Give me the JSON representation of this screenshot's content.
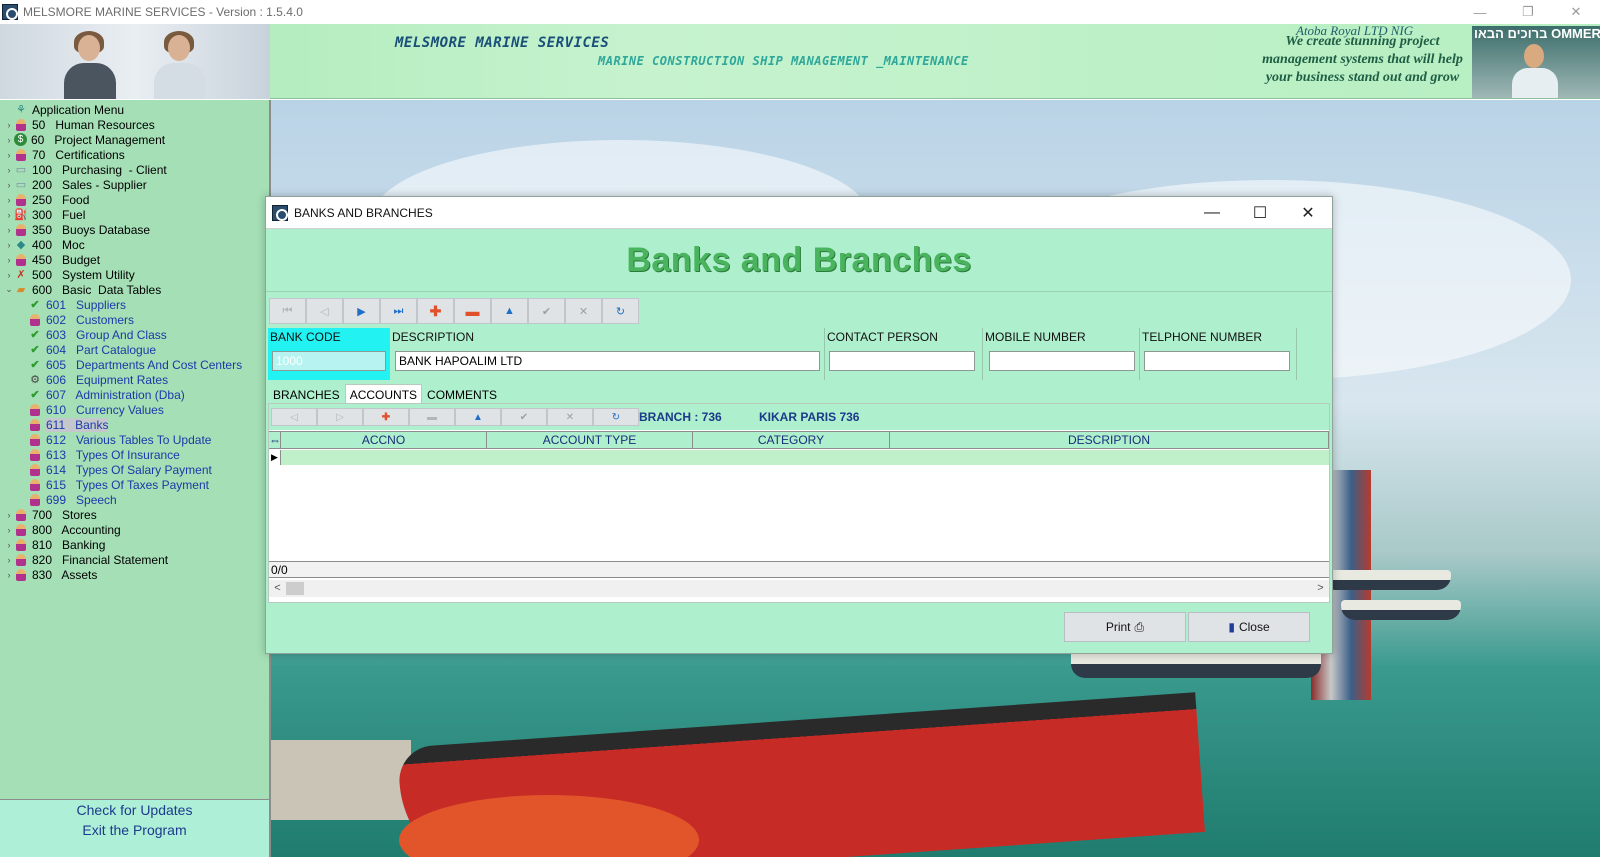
{
  "app": {
    "window_title": "MELSMORE MARINE SERVICES - Version : 1.5.4.0",
    "window_controls": [
      "—",
      "❐",
      "✕"
    ]
  },
  "banner": {
    "company": "MELSMORE MARINE SERVICES",
    "subtitle": "MARINE CONSTRUCTION SHIP MANAGEMENT _MAINTENANCE",
    "tag_title": "Atoba Royal LTD NIG",
    "slogan": "We create stunning project management systems that will help your business stand out and grow",
    "right_photo_text": "ברוכים הבאו OMMERCE"
  },
  "menu": {
    "items": [
      {
        "label": "Application Menu",
        "icon": "tree-icon",
        "expander": "",
        "level": "root"
      },
      {
        "label": "50   Human Resources",
        "icon": "person-icon",
        "expander": "›",
        "level": "top"
      },
      {
        "label": "60   Project Management",
        "icon": "dollar-icon",
        "expander": "›",
        "level": "top"
      },
      {
        "label": "70   Certifications",
        "icon": "person-icon",
        "expander": "›",
        "level": "top"
      },
      {
        "label": "100   Purchasing  - Client",
        "icon": "box-icon",
        "expander": "›",
        "level": "top"
      },
      {
        "label": "200   Sales - Supplier",
        "icon": "box-icon",
        "expander": "›",
        "level": "top"
      },
      {
        "label": "250   Food",
        "icon": "person-icon",
        "expander": "›",
        "level": "top"
      },
      {
        "label": "300   Fuel",
        "icon": "fuel-icon",
        "expander": "›",
        "level": "top"
      },
      {
        "label": "350   Buoys Database",
        "icon": "person-icon",
        "expander": "›",
        "level": "top"
      },
      {
        "label": "400   Moc",
        "icon": "diamond-icon",
        "expander": "›",
        "level": "top"
      },
      {
        "label": "450   Budget",
        "icon": "person-icon",
        "expander": "›",
        "level": "top"
      },
      {
        "label": "500   System Utility",
        "icon": "tools-icon",
        "expander": "›",
        "level": "top"
      },
      {
        "label": "600   Basic  Data Tables",
        "icon": "folder-icon",
        "expander": "⌄",
        "level": "top"
      },
      {
        "label": "601   Suppliers",
        "icon": "check-icon",
        "expander": "",
        "level": "child"
      },
      {
        "label": "602   Customers",
        "icon": "person-icon",
        "expander": "",
        "level": "child"
      },
      {
        "label": "603   Group And Class",
        "icon": "check-icon",
        "expander": "",
        "level": "child"
      },
      {
        "label": "604   Part Catalogue",
        "icon": "check-icon",
        "expander": "",
        "level": "child"
      },
      {
        "label": "605   Departments And Cost Centers",
        "icon": "check-icon",
        "expander": "",
        "level": "child"
      },
      {
        "label": "606   Equipment Rates",
        "icon": "gear-icon",
        "expander": "",
        "level": "child"
      },
      {
        "label": "607   Administration (Dba)",
        "icon": "check-icon",
        "expander": "",
        "level": "child"
      },
      {
        "label": "610   Currency Values",
        "icon": "person-icon",
        "expander": "",
        "level": "child"
      },
      {
        "label": "611   Banks",
        "icon": "person-icon",
        "expander": "",
        "level": "child",
        "selected": true
      },
      {
        "label": "612   Various Tables To Update",
        "icon": "person-icon",
        "expander": "",
        "level": "child"
      },
      {
        "label": "613   Types Of Insurance",
        "icon": "person-icon",
        "expander": "",
        "level": "child"
      },
      {
        "label": "614   Types Of Salary Payment",
        "icon": "person-icon",
        "expander": "",
        "level": "child"
      },
      {
        "label": "615   Types Of Taxes Payment",
        "icon": "person-icon",
        "expander": "",
        "level": "child"
      },
      {
        "label": "699   Speech",
        "icon": "person-icon",
        "expander": "",
        "level": "child"
      },
      {
        "label": "700   Stores",
        "icon": "person-icon",
        "expander": "›",
        "level": "top"
      },
      {
        "label": "800   Accounting",
        "icon": "person-icon",
        "expander": "›",
        "level": "top"
      },
      {
        "label": "810   Banking",
        "icon": "person-icon",
        "expander": "›",
        "level": "top"
      },
      {
        "label": "820   Financial Statement",
        "icon": "person-icon",
        "expander": "›",
        "level": "top"
      },
      {
        "label": "830   Assets",
        "icon": "person-icon",
        "expander": "›",
        "level": "top"
      }
    ],
    "check_updates": "Check for Updates",
    "exit": "Exit the Program"
  },
  "dialog": {
    "title": "BANKS AND BRANCHES",
    "heading": "Banks and Branches",
    "controls": [
      "—",
      "☐",
      "✕"
    ],
    "toolbar": [
      {
        "name": "first-record-button",
        "glyph": "⏮",
        "style": "dis"
      },
      {
        "name": "previous-record-button",
        "glyph": "◁",
        "style": "dis"
      },
      {
        "name": "next-record-button",
        "glyph": "▶",
        "style": "blue"
      },
      {
        "name": "last-record-button",
        "glyph": "⏭",
        "style": "blue"
      },
      {
        "name": "add-record-button",
        "glyph": "✚",
        "style": "red"
      },
      {
        "name": "delete-record-button",
        "glyph": "▬",
        "style": "red"
      },
      {
        "name": "edit-record-button",
        "glyph": "▲",
        "style": "blue"
      },
      {
        "name": "post-edit-button",
        "glyph": "✔",
        "style": "gray"
      },
      {
        "name": "cancel-edit-button",
        "glyph": "✕",
        "style": "gray"
      },
      {
        "name": "refresh-button",
        "glyph": "↻",
        "style": "blue"
      }
    ],
    "fields": {
      "bank_code": {
        "label": "BANK CODE",
        "value": "1000"
      },
      "description": {
        "label": "DESCRIPTION",
        "value": "BANK HAPOALIM LTD"
      },
      "contact_person": {
        "label": "CONTACT PERSON",
        "value": ""
      },
      "mobile_number": {
        "label": "MOBILE NUMBER",
        "value": ""
      },
      "telephone_number": {
        "label": "TELPHONE NUMBER",
        "value": ""
      }
    },
    "tabs": [
      {
        "label": "BRANCHES",
        "active": false
      },
      {
        "label": "ACCOUNTS",
        "active": true
      },
      {
        "label": "COMMENTS",
        "active": false
      }
    ],
    "sub_toolbar": [
      {
        "name": "sub-previous-button",
        "glyph": "◁",
        "style": "dis"
      },
      {
        "name": "sub-next-button",
        "glyph": "▷",
        "style": "dis"
      },
      {
        "name": "sub-add-button",
        "glyph": "✚",
        "style": "red"
      },
      {
        "name": "sub-delete-button",
        "glyph": "▬",
        "style": "dis"
      },
      {
        "name": "sub-edit-button",
        "glyph": "▲",
        "style": "blue"
      },
      {
        "name": "sub-post-button",
        "glyph": "✔",
        "style": "gray"
      },
      {
        "name": "sub-cancel-button",
        "glyph": "✕",
        "style": "gray"
      },
      {
        "name": "sub-refresh-button",
        "glyph": "↻",
        "style": "blue"
      }
    ],
    "branch_label": "BRANCH :  736",
    "branch_name": "KIKAR PARIS 736",
    "grid": {
      "columns": [
        "ACCNO",
        "ACCOUNT TYPE",
        "CATEGORY",
        "DESCRIPTION"
      ],
      "rows": [],
      "record_counter": "0/0"
    },
    "buttons": {
      "print": "Print",
      "close": "Close"
    }
  }
}
